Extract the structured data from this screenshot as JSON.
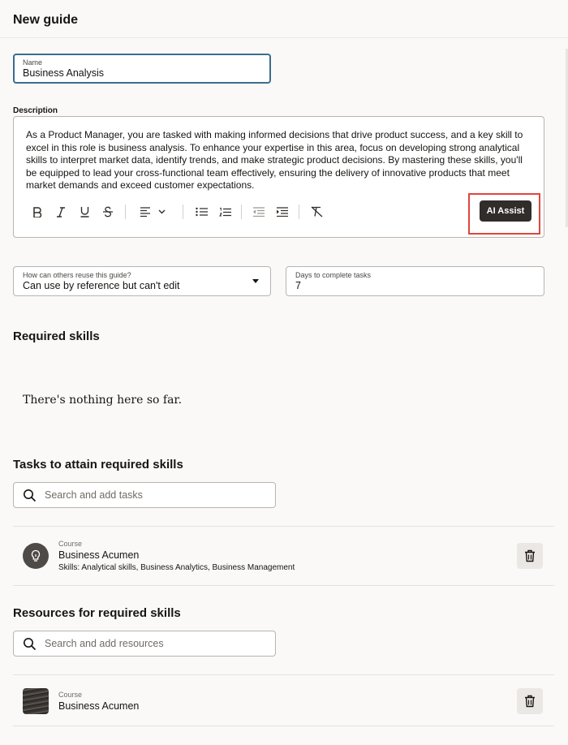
{
  "page": {
    "title": "New guide"
  },
  "name_field": {
    "label": "Name",
    "value": "Business Analysis"
  },
  "description": {
    "label": "Description",
    "text": "As a Product Manager, you are tasked with making informed decisions that drive product success, and a key skill to excel in this role is business analysis. To enhance your expertise in this area, focus on developing strong analytical skills to interpret market data, identify trends, and make strategic product decisions. By mastering these skills, you'll be equipped to lead your cross-functional team effectively, ensuring the delivery of innovative products that meet market demands and exceed customer expectations.",
    "toolbar": [
      "bold-icon",
      "italic-icon",
      "underline-icon",
      "strikethrough-icon",
      "align-icon",
      "bulleted-list-icon",
      "numbered-list-icon",
      "outdent-icon",
      "indent-icon",
      "clear-format-icon"
    ],
    "ai_assist_label": "AI Assist"
  },
  "reuse_select": {
    "label": "How can others reuse this guide?",
    "value": "Can use by reference but can't edit"
  },
  "days_field": {
    "label": "Days to complete tasks",
    "value": "7"
  },
  "required_skills": {
    "heading": "Required skills",
    "empty_text": "There's nothing here so far."
  },
  "tasks": {
    "heading": "Tasks to attain required skills",
    "search_placeholder": "Search and add tasks",
    "items": [
      {
        "type": "Course",
        "title": "Business Acumen",
        "skills": "Skills: Analytical skills, Business Analytics, Business Management"
      }
    ]
  },
  "resources": {
    "heading": "Resources for required skills",
    "search_placeholder": "Search and add resources",
    "items": [
      {
        "type": "Course",
        "title": "Business Acumen"
      }
    ]
  },
  "colors": {
    "primary_button": "#312d2a",
    "focus_border": "#3c6d8d",
    "highlight": "#e0453c",
    "background": "#fbf9f8"
  }
}
